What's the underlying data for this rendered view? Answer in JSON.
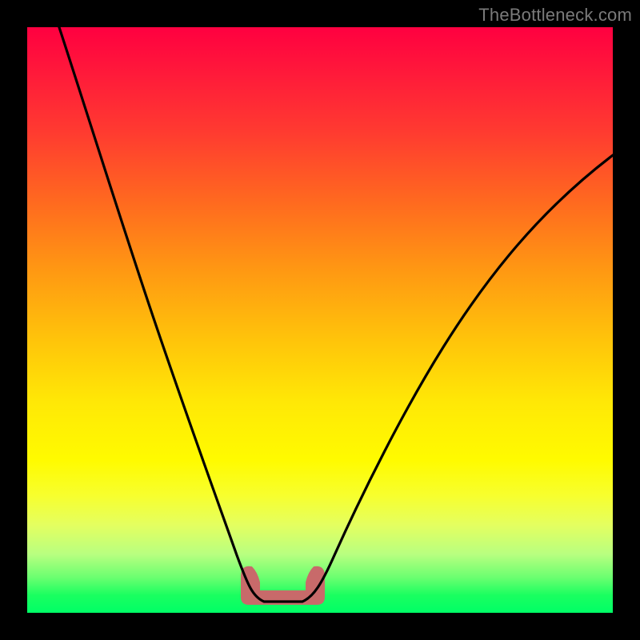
{
  "watermark": "TheBottleneck.com",
  "colors": {
    "frame_bg": "#000000",
    "gradient_top": "#ff0040",
    "gradient_mid_orange": "#ff9a12",
    "gradient_yellow": "#fffb00",
    "gradient_bottom": "#00ff66",
    "curve_stroke": "#000000",
    "bottom_marker": "#c86a6a"
  },
  "chart_data": {
    "type": "line",
    "title": "",
    "xlabel": "",
    "ylabel": "",
    "xlim": [
      0,
      100
    ],
    "ylim": [
      0,
      100
    ],
    "grid": false,
    "series": [
      {
        "name": "bottleneck-curve",
        "x": [
          5,
          10,
          15,
          20,
          25,
          30,
          35,
          37,
          40,
          43,
          45,
          50,
          55,
          60,
          65,
          70,
          75,
          80,
          85,
          90,
          95,
          100
        ],
        "y": [
          100,
          90,
          78,
          65,
          52,
          38,
          23,
          12,
          3,
          1,
          1,
          3,
          9,
          16,
          24,
          32,
          40,
          47,
          54,
          61,
          67,
          72
        ]
      }
    ],
    "annotations": [
      {
        "name": "optimal-range-marker",
        "x_start": 37,
        "x_end": 48,
        "y": 1,
        "color": "#c86a6a",
        "shape": "rounded-flat-bottom"
      }
    ]
  }
}
